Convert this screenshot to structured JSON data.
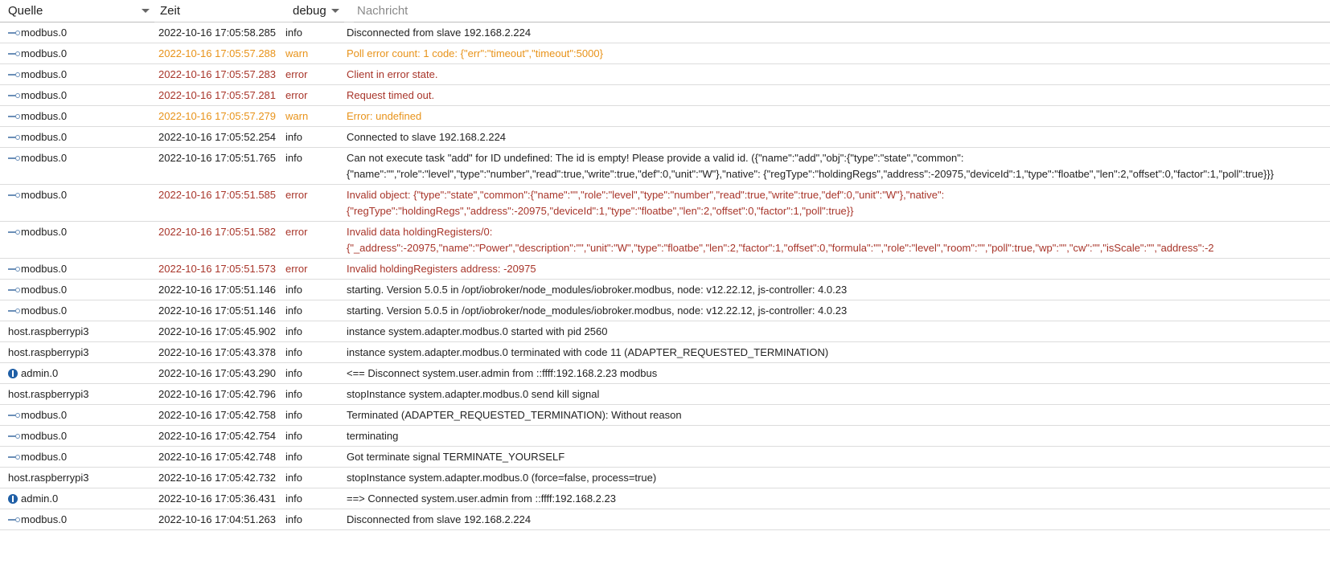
{
  "header": {
    "source_label": "Quelle",
    "time_label": "Zeit",
    "severity_label": "debug",
    "message_label": "Nachricht"
  },
  "rows": [
    {
      "source": "modbus.0",
      "icon": "modbus-icon",
      "time": "2022-10-16 17:05:58.285",
      "severity": "info",
      "message": "Disconnected from slave 192.168.2.224"
    },
    {
      "source": "modbus.0",
      "icon": "modbus-icon",
      "time": "2022-10-16 17:05:57.288",
      "severity": "warn",
      "message": "Poll error count: 1 code: {\"err\":\"timeout\",\"timeout\":5000}"
    },
    {
      "source": "modbus.0",
      "icon": "modbus-icon",
      "time": "2022-10-16 17:05:57.283",
      "severity": "error",
      "message": "Client in error state."
    },
    {
      "source": "modbus.0",
      "icon": "modbus-icon",
      "time": "2022-10-16 17:05:57.281",
      "severity": "error",
      "message": "Request timed out."
    },
    {
      "source": "modbus.0",
      "icon": "modbus-icon",
      "time": "2022-10-16 17:05:57.279",
      "severity": "warn",
      "message": "Error: undefined"
    },
    {
      "source": "modbus.0",
      "icon": "modbus-icon",
      "time": "2022-10-16 17:05:52.254",
      "severity": "info",
      "message": "Connected to slave 192.168.2.224"
    },
    {
      "source": "modbus.0",
      "icon": "modbus-icon",
      "time": "2022-10-16 17:05:51.765",
      "severity": "info",
      "message": "Can not execute task \"add\" for ID undefined: The id is empty! Please provide a valid id. ({\"name\":\"add\",\"obj\":{\"type\":\"state\",\"common\": {\"name\":\"\",\"role\":\"level\",\"type\":\"number\",\"read\":true,\"write\":true,\"def\":0,\"unit\":\"W\"},\"native\": {\"regType\":\"holdingRegs\",\"address\":-20975,\"deviceId\":1,\"type\":\"floatbe\",\"len\":2,\"offset\":0,\"factor\":1,\"poll\":true}}}"
    },
    {
      "source": "modbus.0",
      "icon": "modbus-icon",
      "time": "2022-10-16 17:05:51.585",
      "severity": "error",
      "message": "Invalid object: {\"type\":\"state\",\"common\":{\"name\":\"\",\"role\":\"level\",\"type\":\"number\",\"read\":true,\"write\":true,\"def\":0,\"unit\":\"W\"},\"native\": {\"regType\":\"holdingRegs\",\"address\":-20975,\"deviceId\":1,\"type\":\"floatbe\",\"len\":2,\"offset\":0,\"factor\":1,\"poll\":true}}"
    },
    {
      "source": "modbus.0",
      "icon": "modbus-icon",
      "time": "2022-10-16 17:05:51.582",
      "severity": "error",
      "message": "Invalid data holdingRegisters/0: {\"_address\":-20975,\"name\":\"Power\",\"description\":\"\",\"unit\":\"W\",\"type\":\"floatbe\",\"len\":2,\"factor\":1,\"offset\":0,\"formula\":\"\",\"role\":\"level\",\"room\":\"\",\"poll\":true,\"wp\":\"\",\"cw\":\"\",\"isScale\":\"\",\"address\":-2"
    },
    {
      "source": "modbus.0",
      "icon": "modbus-icon",
      "time": "2022-10-16 17:05:51.573",
      "severity": "error",
      "message": "Invalid holdingRegisters address: -20975"
    },
    {
      "source": "modbus.0",
      "icon": "modbus-icon",
      "time": "2022-10-16 17:05:51.146",
      "severity": "info",
      "message": "starting. Version 5.0.5 in /opt/iobroker/node_modules/iobroker.modbus, node: v12.22.12, js-controller: 4.0.23"
    },
    {
      "source": "modbus.0",
      "icon": "modbus-icon",
      "time": "2022-10-16 17:05:51.146",
      "severity": "info",
      "message": "starting. Version 5.0.5 in /opt/iobroker/node_modules/iobroker.modbus, node: v12.22.12, js-controller: 4.0.23"
    },
    {
      "source": "host.raspberrypi3",
      "icon": "",
      "time": "2022-10-16 17:05:45.902",
      "severity": "info",
      "message": "instance system.adapter.modbus.0 started with pid 2560"
    },
    {
      "source": "host.raspberrypi3",
      "icon": "",
      "time": "2022-10-16 17:05:43.378",
      "severity": "info",
      "message": "instance system.adapter.modbus.0 terminated with code 11 (ADAPTER_REQUESTED_TERMINATION)"
    },
    {
      "source": "admin.0",
      "icon": "admin-icon",
      "time": "2022-10-16 17:05:43.290",
      "severity": "info",
      "message": "<== Disconnect system.user.admin from ::ffff:192.168.2.23 modbus"
    },
    {
      "source": "host.raspberrypi3",
      "icon": "",
      "time": "2022-10-16 17:05:42.796",
      "severity": "info",
      "message": "stopInstance system.adapter.modbus.0 send kill signal"
    },
    {
      "source": "modbus.0",
      "icon": "modbus-icon",
      "time": "2022-10-16 17:05:42.758",
      "severity": "info",
      "message": "Terminated (ADAPTER_REQUESTED_TERMINATION): Without reason"
    },
    {
      "source": "modbus.0",
      "icon": "modbus-icon",
      "time": "2022-10-16 17:05:42.754",
      "severity": "info",
      "message": "terminating"
    },
    {
      "source": "modbus.0",
      "icon": "modbus-icon",
      "time": "2022-10-16 17:05:42.748",
      "severity": "info",
      "message": "Got terminate signal TERMINATE_YOURSELF"
    },
    {
      "source": "host.raspberrypi3",
      "icon": "",
      "time": "2022-10-16 17:05:42.732",
      "severity": "info",
      "message": "stopInstance system.adapter.modbus.0 (force=false, process=true)"
    },
    {
      "source": "admin.0",
      "icon": "admin-icon",
      "time": "2022-10-16 17:05:36.431",
      "severity": "info",
      "message": "==> Connected system.user.admin from ::ffff:192.168.2.23"
    },
    {
      "source": "modbus.0",
      "icon": "modbus-icon",
      "time": "2022-10-16 17:04:51.263",
      "severity": "info",
      "message": "Disconnected from slave 192.168.2.224"
    }
  ]
}
